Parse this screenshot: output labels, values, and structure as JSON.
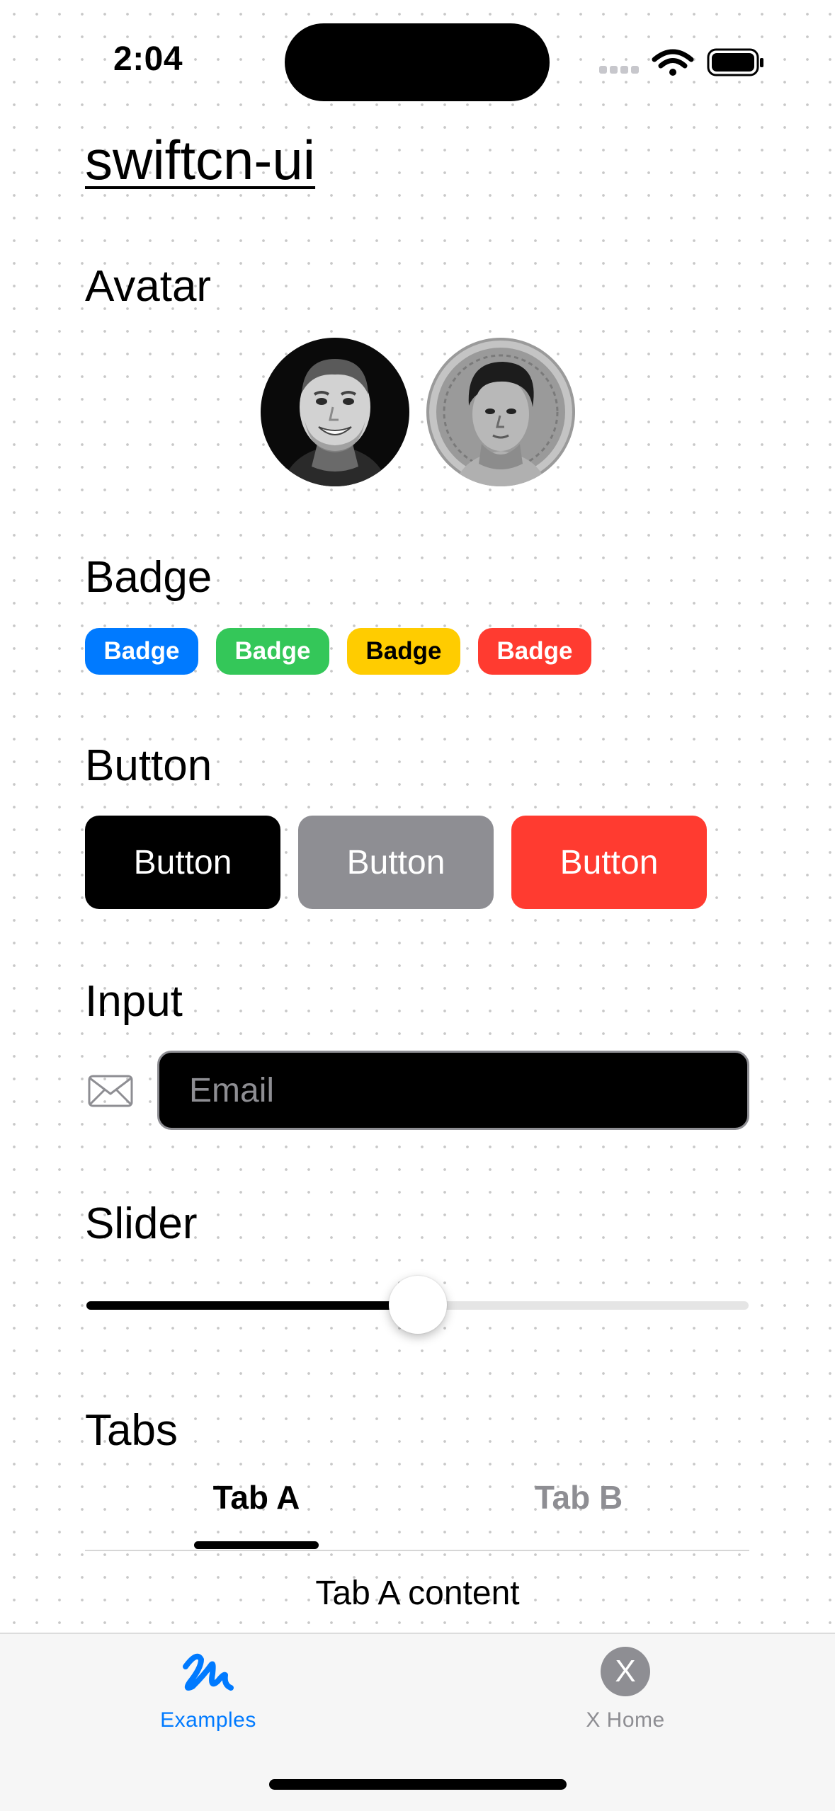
{
  "status_bar": {
    "time": "2:04"
  },
  "app": {
    "title": "swiftcn-ui"
  },
  "sections": {
    "avatar": {
      "title": "Avatar"
    },
    "badge": {
      "title": "Badge",
      "items": [
        {
          "label": "Badge",
          "color": "#007aff",
          "text_color": "#ffffff"
        },
        {
          "label": "Badge",
          "color": "#34c759",
          "text_color": "#ffffff"
        },
        {
          "label": "Badge",
          "color": "#ffcc00",
          "text_color": "#000000"
        },
        {
          "label": "Badge",
          "color": "#ff3b30",
          "text_color": "#ffffff"
        }
      ]
    },
    "button": {
      "title": "Button",
      "items": [
        {
          "label": "Button",
          "color": "#000000"
        },
        {
          "label": "Button",
          "color": "#8e8e93"
        },
        {
          "label": "Button",
          "color": "#ff3b30"
        }
      ]
    },
    "input": {
      "title": "Input",
      "placeholder": "Email",
      "icon": "envelope-icon"
    },
    "slider": {
      "title": "Slider",
      "value": 0.5
    },
    "tabs": {
      "title": "Tabs",
      "items": [
        {
          "label": "Tab A",
          "selected": true
        },
        {
          "label": "Tab B",
          "selected": false
        }
      ],
      "content": "Tab A content"
    }
  },
  "tab_bar": {
    "items": [
      {
        "label": "Examples",
        "icon": "scribble-icon",
        "selected": true
      },
      {
        "label": "X Home",
        "icon": "x-circle-icon",
        "icon_text": "X",
        "selected": false
      }
    ],
    "accent": "#007aff",
    "inactive": "#8e8e93"
  }
}
